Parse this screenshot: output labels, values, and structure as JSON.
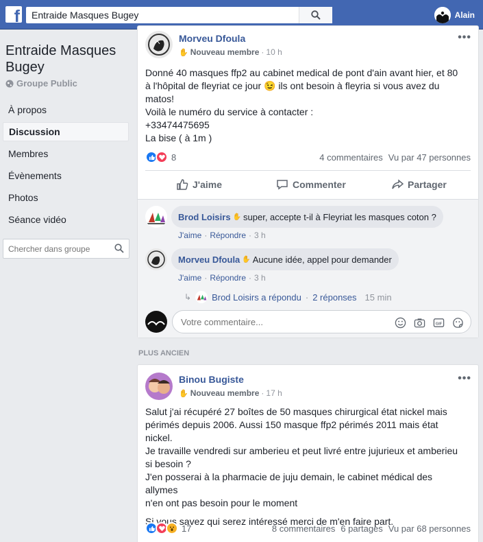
{
  "topbar": {
    "logo": "f",
    "search_value": "Entraide Masques Bugey",
    "user_name": "Alain",
    "search_icon": "search-icon"
  },
  "sidebar": {
    "group_name": "Entraide Masques Bugey",
    "group_type": "Groupe Public",
    "items": [
      {
        "label": "À propos"
      },
      {
        "label": "Discussion"
      },
      {
        "label": "Membres"
      },
      {
        "label": "Évènements"
      },
      {
        "label": "Photos"
      },
      {
        "label": "Séance vidéo"
      }
    ],
    "search_placeholder": "Chercher dans groupe"
  },
  "post1": {
    "author": "Morveu Dfoula",
    "badge": "Nouveau membre",
    "time": "10 h",
    "lines": [
      "Donné 40 masques ffp2 au cabinet medical de pont d'ain avant hier, et 80",
      "à l'hôpital de fleyriat ce jour 😉 ils ont besoin à fleyria si vous avez du",
      "matos!",
      "Voilà le numéro du service à contacter :",
      "+33474475695",
      "La bise ( à 1m )"
    ],
    "reaction_count": "8",
    "comments_count": "4 commentaires",
    "views": "Vu par 47 personnes",
    "like_label": "J'aime",
    "comment_label": "Commenter",
    "share_label": "Partager",
    "comments": [
      {
        "author": "Brod Loisirs",
        "text": "super, accepte t-il à Fleyriat les masques coton ?",
        "like": "J'aime",
        "reply": "Répondre",
        "time": "3 h"
      },
      {
        "author": "Morveu Dfoula",
        "text": "Aucune idée, appel pour demander",
        "like": "J'aime",
        "reply": "Répondre",
        "time": "3 h"
      }
    ],
    "reply_summary": {
      "author_text": "Brod Loisirs a répondu",
      "count": "2 réponses",
      "time": "15 min"
    },
    "write_placeholder": "Votre commentaire..."
  },
  "older_label": "PLUS ANCIEN",
  "post2": {
    "author": "Binou Bugiste",
    "badge": "Nouveau membre",
    "time": "17 h",
    "lines": [
      "Salut j'ai récupéré 27 boîtes de 50 masques chirurgical état nickel mais",
      "périmés depuis 2006. Aussi 150 masque ffp2 périmés 2011 mais état",
      "nickel.",
      "Je travaille vendredi sur amberieu et peut livré entre jujurieux et amberieu",
      "si besoin ?",
      "J'en posserai à la pharmacie de juju demain, le cabinet médical des allymes",
      "n'en ont pas besoin pour le moment"
    ],
    "last_line": "Si vous savez qui serez intéressé merci de m'en faire part.",
    "reaction_count": "17",
    "comments_count": "8 commentaires",
    "shares": "6 partages",
    "views": "Vu par 68 personnes"
  },
  "colors": {
    "brand": "#4267b2",
    "link": "#385898",
    "like": "#1877f2",
    "love": "#f33e58",
    "wow": "#f7b125"
  }
}
